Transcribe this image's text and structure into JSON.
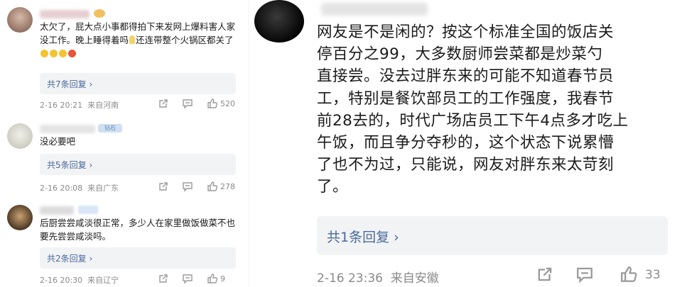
{
  "left_comments": [
    {
      "text": "太欠了，屁大点小事都得拍下来发网上爆料害人家没工作。晚上睡得着吗",
      "text_tail": "还连带整个火锅区都关了",
      "reply_label": "共7条回复 ›",
      "time": "2-16 20:21",
      "location": "来自河南",
      "likes": "520"
    },
    {
      "badge": "钻石",
      "text": "没必要吧",
      "reply_label": "共5条回复 ›",
      "time": "2-16 20:08",
      "location": "来自广东",
      "likes": "278"
    },
    {
      "text": "后厨尝尝咸淡很正常，多少人在家里做饭做菜不也要先尝尝咸淡吗。",
      "reply_label": "共2条回复 ›",
      "time": "2-16 20:30",
      "location": "来自辽宁",
      "likes": "9"
    }
  ],
  "right_comment": {
    "lines": [
      "网友是不是闲的？按这个标准全国的饭店关",
      "停百分之99，大多数厨师尝菜都是炒菜勺",
      "直接尝。没去过胖东来的可能不知道春节员",
      "工，特别是餐饮部员工的工作强度，我春节",
      "前28去的，时代广场店员工下午4点多才吃上",
      "午饭，而且争分夺秒的，这个状态下说累懵",
      "了也不为过，只能说，网友对胖东来太苛刻",
      "了。"
    ],
    "reply_label": "共1条回复 ›",
    "time": "2-16 23:36",
    "location": "来自安徽",
    "likes": "33"
  },
  "icons": [
    "share-icon",
    "comment-icon",
    "like-icon"
  ],
  "colors": {
    "link": "#4a6a9a",
    "meta": "#8a8a8a",
    "reply_bg": "#f2f3f5"
  }
}
